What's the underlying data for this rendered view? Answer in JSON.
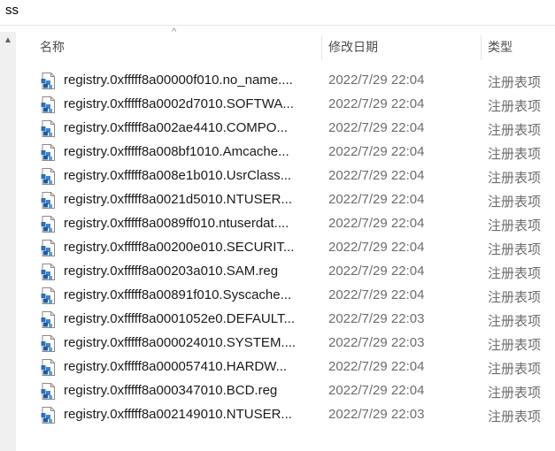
{
  "window": {
    "title": "ss"
  },
  "columns": {
    "name": "名称",
    "date": "修改日期",
    "type": "类型"
  },
  "files": [
    {
      "name": "registry.0xfffff8a00000f010.no_name....",
      "date": "2022/7/29 22:04",
      "type": "注册表项"
    },
    {
      "name": "registry.0xfffff8a0002d7010.SOFTWA...",
      "date": "2022/7/29 22:04",
      "type": "注册表项"
    },
    {
      "name": "registry.0xfffff8a002ae4410.COMPO...",
      "date": "2022/7/29 22:04",
      "type": "注册表项"
    },
    {
      "name": "registry.0xfffff8a008bf1010.Amcache...",
      "date": "2022/7/29 22:04",
      "type": "注册表项"
    },
    {
      "name": "registry.0xfffff8a008e1b010.UsrClass...",
      "date": "2022/7/29 22:04",
      "type": "注册表项"
    },
    {
      "name": "registry.0xfffff8a0021d5010.NTUSER...",
      "date": "2022/7/29 22:04",
      "type": "注册表项"
    },
    {
      "name": "registry.0xfffff8a0089ff010.ntuserdat....",
      "date": "2022/7/29 22:04",
      "type": "注册表项"
    },
    {
      "name": "registry.0xfffff8a00200e010.SECURIT...",
      "date": "2022/7/29 22:04",
      "type": "注册表项"
    },
    {
      "name": "registry.0xfffff8a00203a010.SAM.reg",
      "date": "2022/7/29 22:04",
      "type": "注册表项"
    },
    {
      "name": "registry.0xfffff8a00891f010.Syscache...",
      "date": "2022/7/29 22:04",
      "type": "注册表项"
    },
    {
      "name": "registry.0xfffff8a0001052e0.DEFAULT...",
      "date": "2022/7/29 22:03",
      "type": "注册表项"
    },
    {
      "name": "registry.0xfffff8a000024010.SYSTEM....",
      "date": "2022/7/29 22:03",
      "type": "注册表项"
    },
    {
      "name": "registry.0xfffff8a000057410.HARDW...",
      "date": "2022/7/29 22:04",
      "type": "注册表项"
    },
    {
      "name": "registry.0xfffff8a000347010.BCD.reg",
      "date": "2022/7/29 22:04",
      "type": "注册表项"
    },
    {
      "name": "registry.0xfffff8a002149010.NTUSER...",
      "date": "2022/7/29 22:03",
      "type": "注册表项"
    }
  ],
  "icons": {
    "file": "registry-file-icon",
    "sort": "sort-up-arrow-icon",
    "scroll_up": "scroll-up-arrow-icon"
  },
  "colors": {
    "accent": "#2b6fb6",
    "text": "#1a1a1a",
    "muted": "#6d6d6d"
  }
}
